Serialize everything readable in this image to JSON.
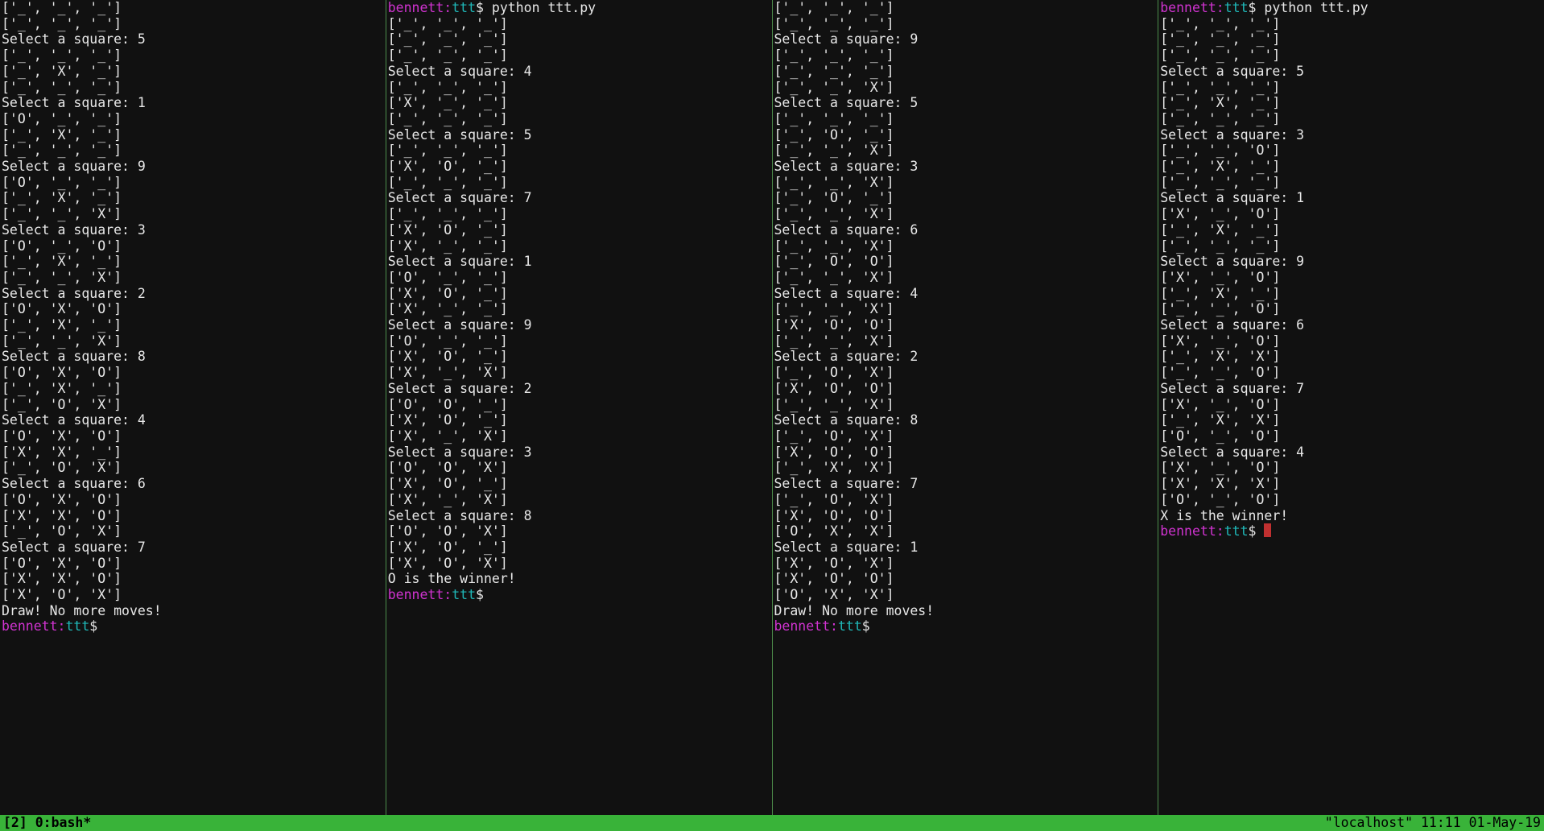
{
  "colors": {
    "magenta": "#d033d0",
    "cyan": "#1fb8b8",
    "green": "#39b339",
    "cursor": "#c03030"
  },
  "prompt": {
    "user": "bennett",
    "sep": ":",
    "host": "ttt",
    "dollar": "$"
  },
  "cmd": "python ttt.py",
  "status": {
    "left": "[2] 0:bash*",
    "right_host": "\"localhost\"",
    "right_time": "11:11 01-May-19"
  },
  "panes": [
    {
      "lines": [
        "['_', '_', '_']",
        "['_', '_', '_']",
        "Select a square: 5",
        "['_', '_', '_']",
        "['_', 'X', '_']",
        "['_', '_', '_']",
        "Select a square: 1",
        "['O', '_', '_']",
        "['_', 'X', '_']",
        "['_', '_', '_']",
        "Select a square: 9",
        "['O', '_', '_']",
        "['_', 'X', '_']",
        "['_', '_', 'X']",
        "Select a square: 3",
        "['O', '_', 'O']",
        "['_', 'X', '_']",
        "['_', '_', 'X']",
        "Select a square: 2",
        "['O', 'X', 'O']",
        "['_', 'X', '_']",
        "['_', '_', 'X']",
        "Select a square: 8",
        "['O', 'X', 'O']",
        "['_', 'X', '_']",
        "['_', 'O', 'X']",
        "Select a square: 4",
        "['O', 'X', 'O']",
        "['X', 'X', '_']",
        "['_', 'O', 'X']",
        "Select a square: 6",
        "['O', 'X', 'O']",
        "['X', 'X', 'O']",
        "['_', 'O', 'X']",
        "Select a square: 7",
        "['O', 'X', 'O']",
        "['X', 'X', 'O']",
        "['X', 'O', 'X']",
        "Draw! No more moves!"
      ],
      "prompt_after": true
    },
    {
      "cmd_before": true,
      "lines": [
        "['_', '_', '_']",
        "['_', '_', '_']",
        "['_', '_', '_']",
        "Select a square: 4",
        "['_', '_', '_']",
        "['X', '_', '_']",
        "['_', '_', '_']",
        "Select a square: 5",
        "['_', '_', '_']",
        "['X', 'O', '_']",
        "['_', '_', '_']",
        "Select a square: 7",
        "['_', '_', '_']",
        "['X', 'O', '_']",
        "['X', '_', '_']",
        "Select a square: 1",
        "['O', '_', '_']",
        "['X', 'O', '_']",
        "['X', '_', '_']",
        "Select a square: 9",
        "['O', '_', '_']",
        "['X', 'O', '_']",
        "['X', '_', 'X']",
        "Select a square: 2",
        "['O', 'O', '_']",
        "['X', 'O', '_']",
        "['X', '_', 'X']",
        "Select a square: 3",
        "['O', 'O', 'X']",
        "['X', 'O', '_']",
        "['X', '_', 'X']",
        "Select a square: 8",
        "['O', 'O', 'X']",
        "['X', 'O', '_']",
        "['X', 'O', 'X']",
        "O is the winner!"
      ],
      "prompt_after": true
    },
    {
      "lines": [
        "['_', '_', '_']",
        "['_', '_', '_']",
        "Select a square: 9",
        "['_', '_', '_']",
        "['_', '_', '_']",
        "['_', '_', 'X']",
        "Select a square: 5",
        "['_', '_', '_']",
        "['_', 'O', '_']",
        "['_', '_', 'X']",
        "Select a square: 3",
        "['_', '_', 'X']",
        "['_', 'O', '_']",
        "['_', '_', 'X']",
        "Select a square: 6",
        "['_', '_', 'X']",
        "['_', 'O', 'O']",
        "['_', '_', 'X']",
        "Select a square: 4",
        "['_', '_', 'X']",
        "['X', 'O', 'O']",
        "['_', '_', 'X']",
        "Select a square: 2",
        "['_', 'O', 'X']",
        "['X', 'O', 'O']",
        "['_', '_', 'X']",
        "Select a square: 8",
        "['_', 'O', 'X']",
        "['X', 'O', 'O']",
        "['_', 'X', 'X']",
        "Select a square: 7",
        "['_', 'O', 'X']",
        "['X', 'O', 'O']",
        "['O', 'X', 'X']",
        "Select a square: 1",
        "['X', 'O', 'X']",
        "['X', 'O', 'O']",
        "['O', 'X', 'X']",
        "Draw! No more moves!"
      ],
      "prompt_after": true
    },
    {
      "cmd_before": true,
      "lines": [
        "['_', '_', '_']",
        "['_', '_', '_']",
        "['_', '_', '_']",
        "Select a square: 5",
        "['_', '_', '_']",
        "['_', 'X', '_']",
        "['_', '_', '_']",
        "Select a square: 3",
        "['_', '_', 'O']",
        "['_', 'X', '_']",
        "['_', '_', '_']",
        "Select a square: 1",
        "['X', '_', 'O']",
        "['_', 'X', '_']",
        "['_', '_', '_']",
        "Select a square: 9",
        "['X', '_', 'O']",
        "['_', 'X', '_']",
        "['_', '_', 'O']",
        "Select a square: 6",
        "['X', '_', 'O']",
        "['_', 'X', 'X']",
        "['_', '_', 'O']",
        "Select a square: 7",
        "['X', '_', 'O']",
        "['_', 'X', 'X']",
        "['O', '_', 'O']",
        "Select a square: 4",
        "['X', '_', 'O']",
        "['X', 'X', 'X']",
        "['O', '_', 'O']",
        "X is the winner!"
      ],
      "prompt_after": true,
      "cursor_after": true
    }
  ]
}
